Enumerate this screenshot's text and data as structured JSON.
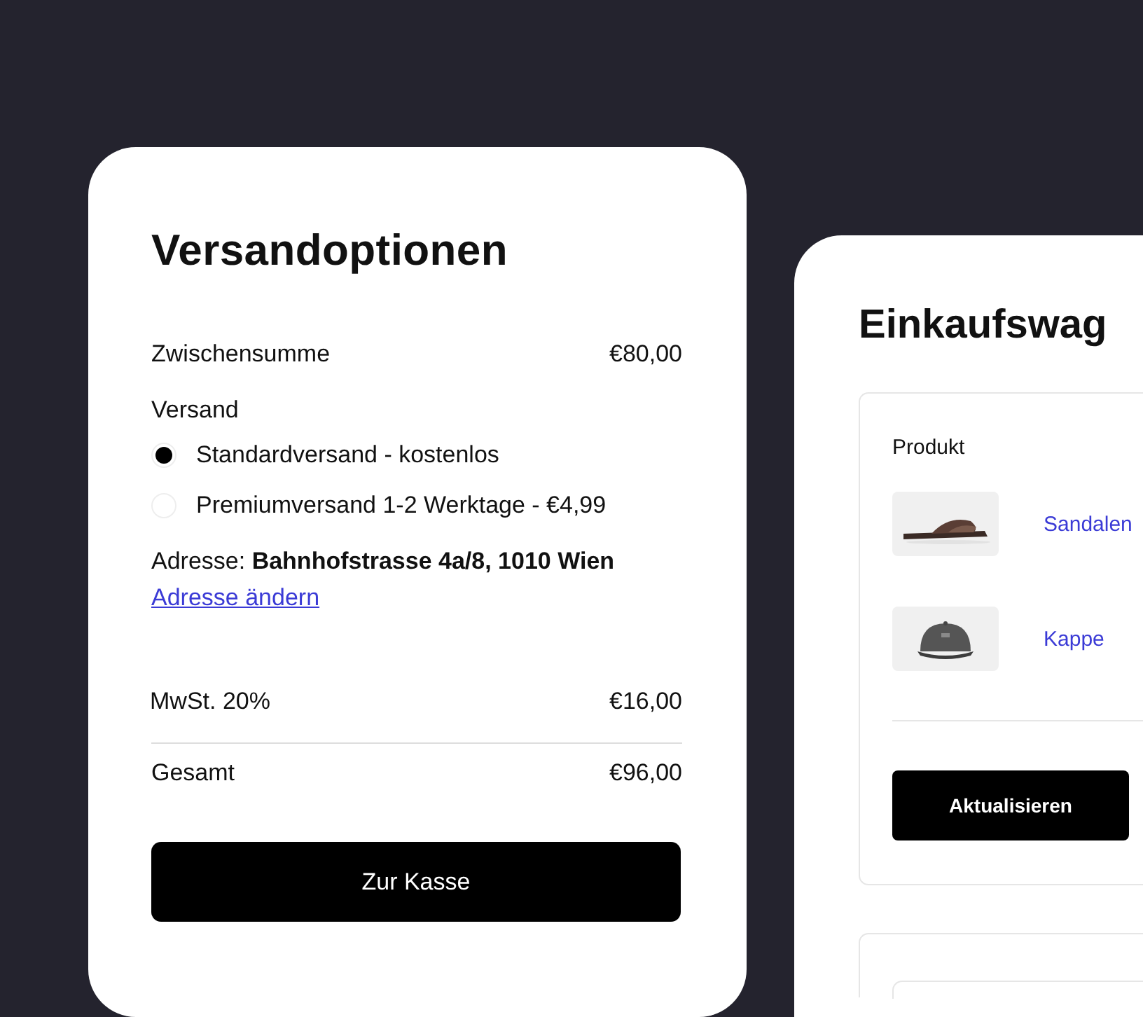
{
  "shipping": {
    "title": "Versandoptionen",
    "subtotal": {
      "label": "Zwischensumme",
      "value": "€80,00"
    },
    "shipping_label": "Versand",
    "options": [
      {
        "label": "Standardversand - kostenlos",
        "selected": true
      },
      {
        "label": "Premiumversand 1-2 Werktage - €4,99",
        "selected": false
      }
    ],
    "address": "Adresse: **Bahnhofstrasse 4a/8, 1010 Wien**",
    "change_address": "Adresse ändern",
    "tax": {
      "label": "MwSt. 20%",
      "value": "€16,00"
    },
    "total": {
      "label": "Gesamt",
      "value": "€96,00"
    },
    "checkout_button": "Zur Kasse"
  },
  "cart": {
    "title": "Einkaufswag",
    "column_header": "Produkt",
    "products": [
      {
        "name": "Sandalen",
        "kind": "sandal"
      },
      {
        "name": "Kappe",
        "kind": "cap"
      }
    ],
    "update_button": "Aktualisieren"
  }
}
